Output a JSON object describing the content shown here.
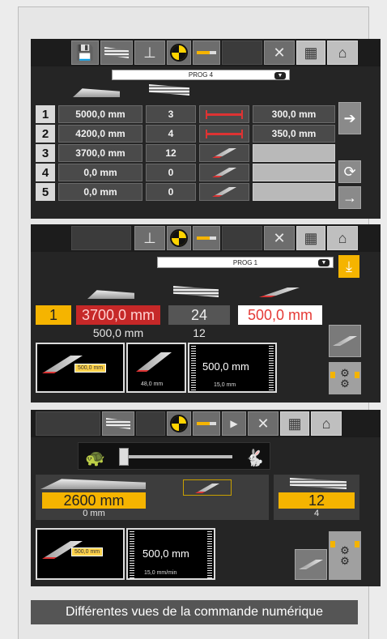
{
  "screen1": {
    "toolbar_icons": [
      "save-icon",
      "profile-icon",
      "clamp-icon",
      "target-icon",
      "cutter-icon",
      "tools-icon",
      "calculator-icon",
      "home-icon"
    ],
    "program_select": "PROG 4",
    "rows": [
      {
        "index": "1",
        "length": "5000,0 mm",
        "qty": "3",
        "offset": "300,0 mm"
      },
      {
        "index": "2",
        "length": "4200,0 mm",
        "qty": "4",
        "offset": "350,0 mm"
      },
      {
        "index": "3",
        "length": "3700,0 mm",
        "qty": "12",
        "offset": ""
      },
      {
        "index": "4",
        "length": "0,0 mm",
        "qty": "0",
        "offset": ""
      },
      {
        "index": "5",
        "length": "0,0 mm",
        "qty": "0",
        "offset": ""
      }
    ],
    "side_icons": [
      "export-icon",
      "cycle-icon",
      "next-arrow-icon"
    ]
  },
  "screen2": {
    "toolbar_icons": [
      "clamp-icon",
      "target-icon",
      "cutter-icon",
      "tools-icon",
      "calculator-icon",
      "home-icon"
    ],
    "program_select": "PROG 1",
    "current_index": "1",
    "target_length": "3700,0 mm",
    "target_qty": "24",
    "target_offset": "500,0 mm",
    "actual_length": "500,0 mm",
    "actual_qty": "12",
    "panel_left_tag": "500,0 mm",
    "panel_mid_value": "48,0 mm",
    "panel_right_value": "500,0 mm",
    "panel_right_sub": "15,0 mm"
  },
  "screen3": {
    "toolbar_icons": [
      "profile-icon",
      "target-icon",
      "cutter-icon",
      "play-icon",
      "tools-icon",
      "calculator-icon",
      "home-icon"
    ],
    "length_value": "2600 mm",
    "length_actual": "0 mm",
    "qty_value": "12",
    "qty_actual": "4",
    "panel_tag": "500,0 mm",
    "panel_value": "500,0 mm",
    "panel_sub": "15,0 mm/min"
  },
  "caption": "Différentes vues de la commande numérique",
  "colors": {
    "accent": "#f5b400",
    "alert": "#e53935",
    "panel": "#252525"
  }
}
